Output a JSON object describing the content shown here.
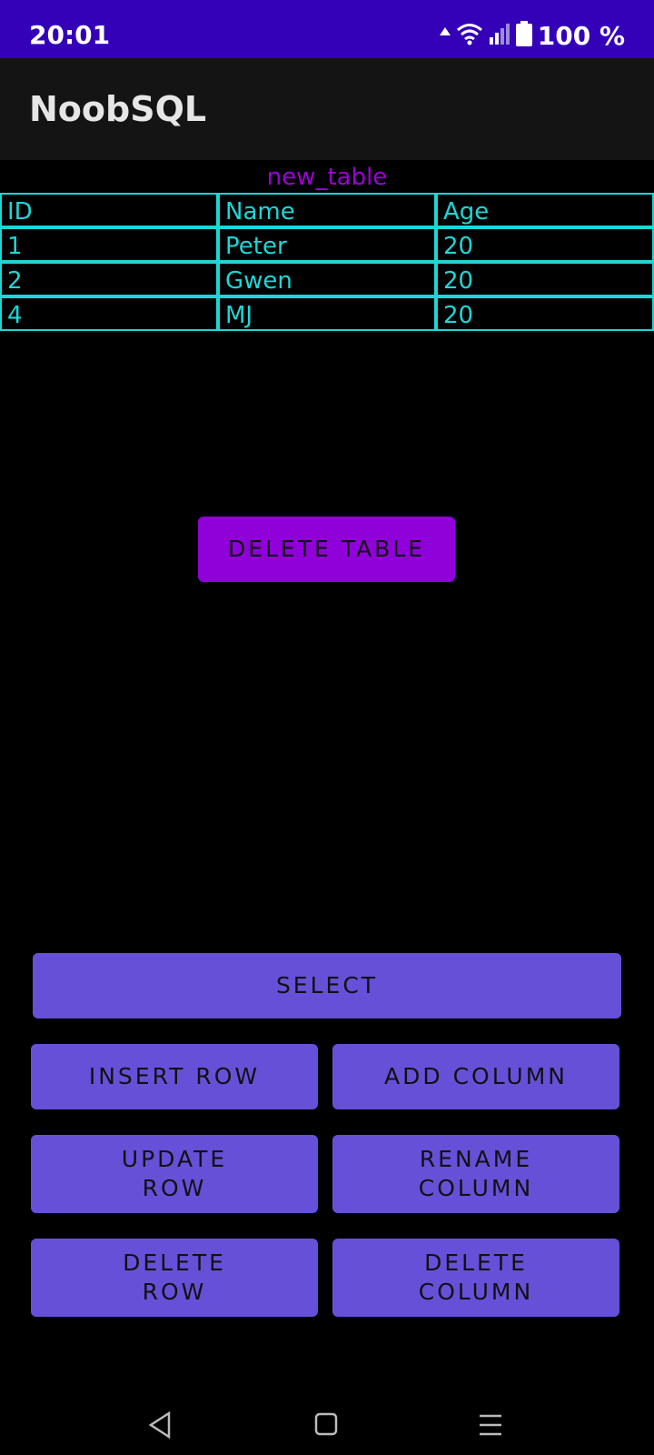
{
  "status_bar": {
    "time": "20:01",
    "battery": "100 %"
  },
  "app_bar": {
    "title": "NoobSQL"
  },
  "table": {
    "name": "new_table",
    "headers": [
      "ID",
      "Name",
      "Age"
    ],
    "rows": [
      [
        "1",
        "Peter",
        "20"
      ],
      [
        "2",
        "Gwen",
        "20"
      ],
      [
        "4",
        "MJ",
        "20"
      ]
    ]
  },
  "buttons": {
    "delete_table": "DELETE TABLE",
    "select": "SELECT",
    "insert_row": "INSERT ROW",
    "add_column": "ADD COLUMN",
    "update_row": "UPDATE\nROW",
    "rename_column": "RENAME\nCOLUMN",
    "delete_row": "DELETE\nROW",
    "delete_column": "DELETE\nCOLUMN"
  },
  "colors": {
    "status_bar": "#3400b8",
    "table_name": "#9b00d6",
    "grid": "#1ed6d6",
    "delete_table_button": "#9000d9",
    "action_button": "#6750d8"
  },
  "nav_bar": {
    "icons": [
      "back-icon",
      "home-icon",
      "recents-icon"
    ]
  }
}
